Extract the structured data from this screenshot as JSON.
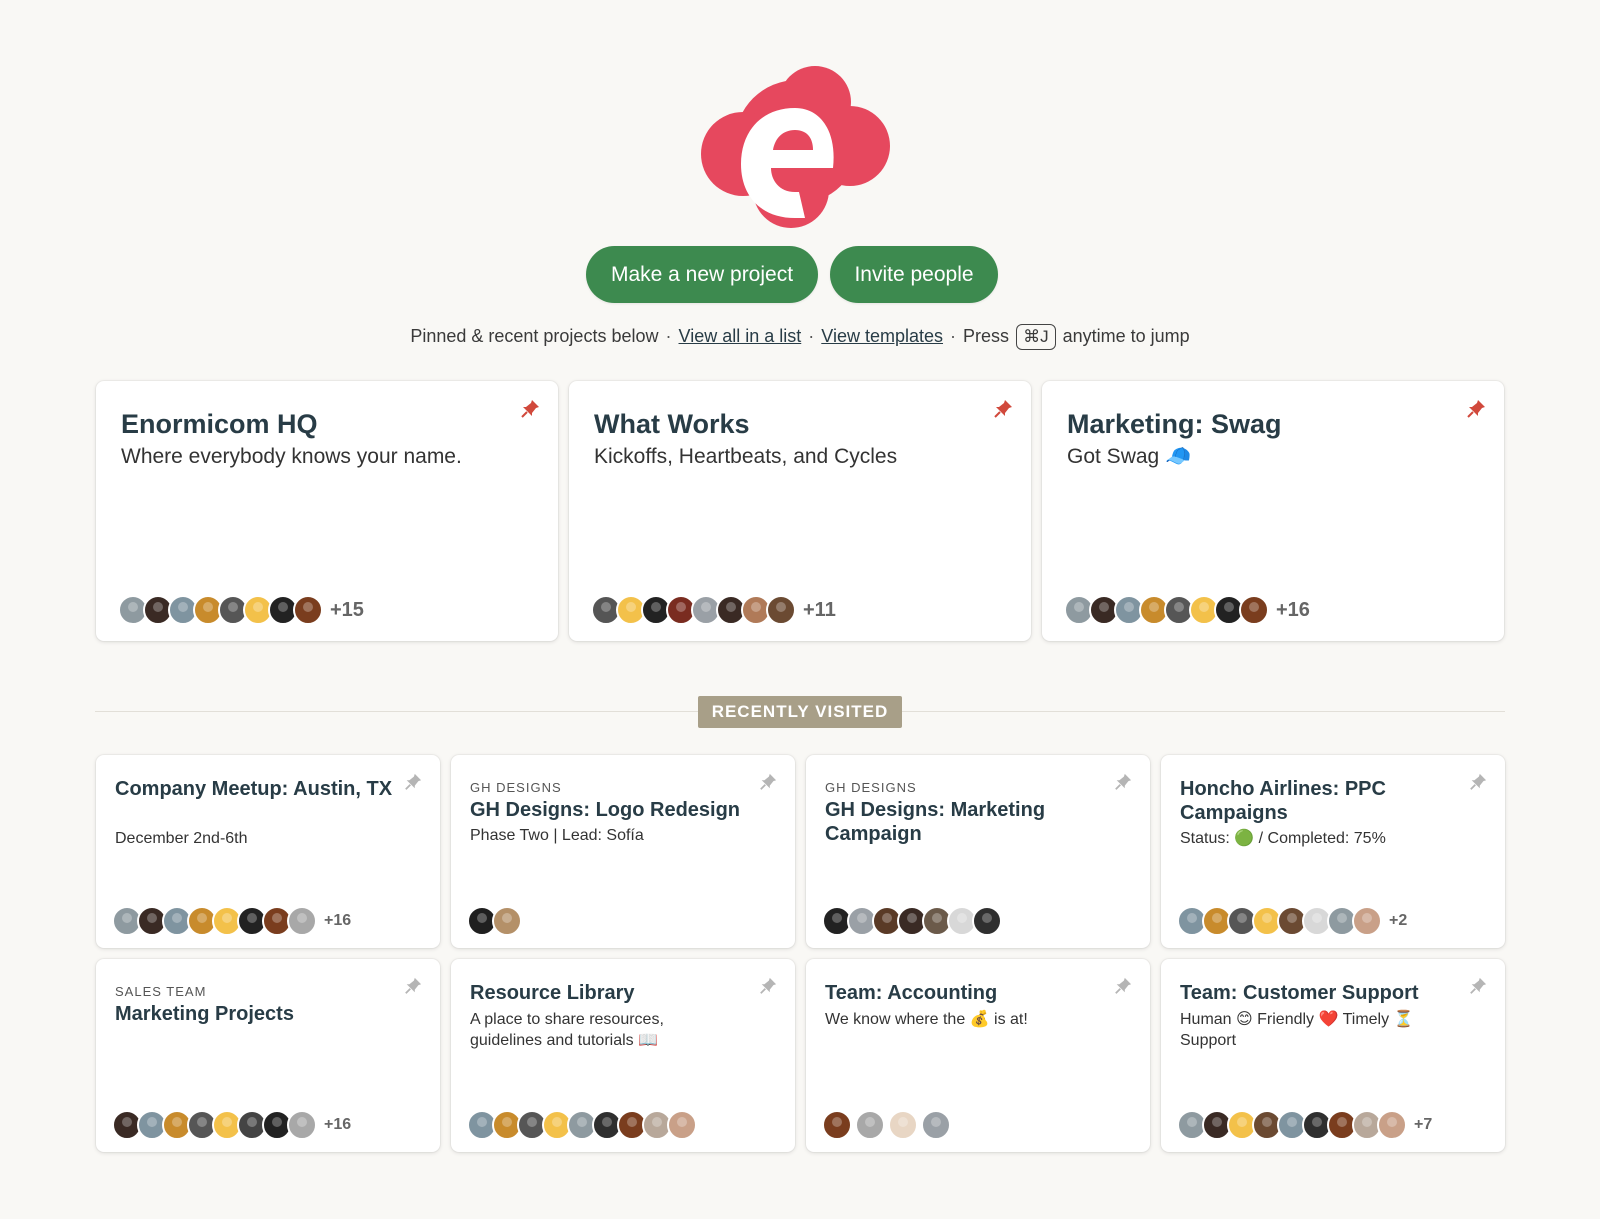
{
  "brand": {
    "logo_icon": "enormicom-e-cloud-logo",
    "color": "#e6485e"
  },
  "actions": {
    "new_project": "Make a new project",
    "invite": "Invite people",
    "color": "#3d8a4f"
  },
  "subline": {
    "prefix": "Pinned & recent projects below",
    "view_list": "View all in a list",
    "view_templates": "View templates",
    "press": "Press",
    "shortcut": "⌘J",
    "suffix": "anytime to jump"
  },
  "pinned": [
    {
      "title": "Enormicom HQ",
      "desc": "Where everybody knows your name.",
      "more": "+15",
      "pinned": true
    },
    {
      "title": "What Works",
      "desc": "Kickoffs, Heartbeats, and Cycles",
      "more": "+11",
      "pinned": true
    },
    {
      "title": "Marketing: Swag",
      "desc": "Got Swag 🧢",
      "more": "+16",
      "pinned": true
    }
  ],
  "recent_label": "RECENTLY VISITED",
  "recent": [
    {
      "eyebrow": "",
      "title": "Company Meetup: Austin, TX",
      "desc": "December 2nd-6th",
      "more": "+16"
    },
    {
      "eyebrow": "GH DESIGNS",
      "title": "GH Designs: Logo Redesign",
      "desc": "Phase Two | Lead: Sofía",
      "more": ""
    },
    {
      "eyebrow": "GH DESIGNS",
      "title": "GH Designs: Marketing Campaign",
      "desc": "",
      "more": ""
    },
    {
      "eyebrow": "",
      "title": "Honcho Airlines: PPC Campaigns",
      "desc": "Status: 🟢 / Completed: 75%",
      "more": "+2"
    },
    {
      "eyebrow": "SALES TEAM",
      "title": "Marketing Projects",
      "desc": "",
      "more": "+16"
    },
    {
      "eyebrow": "",
      "title": "Resource Library",
      "desc": "A place to share resources, guidelines and tutorials 📖",
      "more": ""
    },
    {
      "eyebrow": "",
      "title": "Team: Accounting",
      "desc": "We know where the 💰 is at!",
      "more": ""
    },
    {
      "eyebrow": "",
      "title": "Team: Customer Support",
      "desc": "Human 😊 Friendly ❤️ Timely ⏳ Support",
      "more": "+7"
    }
  ],
  "pin_colors": {
    "pinned": "#d1493c",
    "unpinned": "#b5b5b5"
  }
}
